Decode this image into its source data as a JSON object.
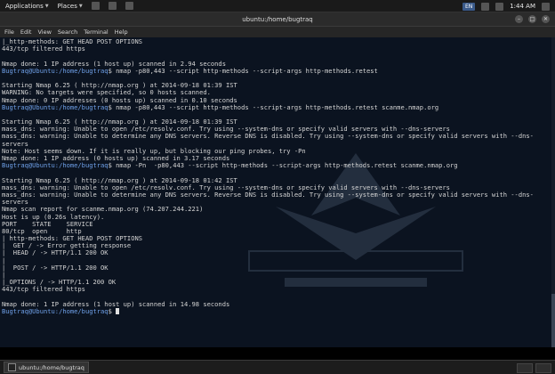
{
  "topbar": {
    "applications": "Applications",
    "places": "Places",
    "keyboard_layout": "EN",
    "time": "1:44 AM"
  },
  "window": {
    "title": "ubuntu:/home/bugtraq"
  },
  "menubar": [
    "File",
    "Edit",
    "View",
    "Search",
    "Terminal",
    "Help"
  ],
  "terminal": {
    "prompt_user": "Bugtraq@Ubuntu:",
    "prompt_path": "/home/bugtraq",
    "lines": [
      {
        "text": "|_http-methods: GET HEAD POST OPTIONS"
      },
      {
        "text": "443/tcp filtered https"
      },
      {
        "text": ""
      },
      {
        "text": "Nmap done: 1 IP address (1 host up) scanned in 2.94 seconds"
      },
      {
        "prompt": true,
        "text": "$ nmap -p80,443 --script http-methods --script-args http-methods.retest"
      },
      {
        "text": ""
      },
      {
        "text": "Starting Nmap 6.25 ( http://nmap.org ) at 2014-09-18 01:39 IST"
      },
      {
        "text": "WARNING: No targets were specified, so 0 hosts scanned."
      },
      {
        "text": "Nmap done: 0 IP addresses (0 hosts up) scanned in 0.10 seconds"
      },
      {
        "prompt": true,
        "text": "$ nmap -p80,443 --script http-methods --script-args http-methods.retest scanme.nmap.org"
      },
      {
        "text": ""
      },
      {
        "text": "Starting Nmap 6.25 ( http://nmap.org ) at 2014-09-18 01:39 IST"
      },
      {
        "text": "mass_dns: warning: Unable to open /etc/resolv.conf. Try using --system-dns or specify valid servers with --dns-servers"
      },
      {
        "text": "mass_dns: warning: Unable to determine any DNS servers. Reverse DNS is disabled. Try using --system-dns or specify valid servers with --dns-"
      },
      {
        "text": "servers"
      },
      {
        "text": "Note: Host seems down. If it is really up, but blocking our ping probes, try -Pn"
      },
      {
        "text": "Nmap done: 1 IP address (0 hosts up) scanned in 3.17 seconds"
      },
      {
        "prompt": true,
        "text": "$ nmap -Pn  -p80,443 --script http-methods --script-args http-methods.retest scanme.nmap.org"
      },
      {
        "text": ""
      },
      {
        "text": "Starting Nmap 6.25 ( http://nmap.org ) at 2014-09-18 01:42 IST"
      },
      {
        "text": "mass_dns: warning: Unable to open /etc/resolv.conf. Try using --system-dns or specify valid servers with --dns-servers"
      },
      {
        "text": "mass_dns: warning: Unable to determine any DNS servers. Reverse DNS is disabled. Try using --system-dns or specify valid servers with --dns-"
      },
      {
        "text": "servers"
      },
      {
        "text": "Nmap scan report for scanme.nmap.org (74.207.244.221)"
      },
      {
        "text": "Host is up (0.26s latency)."
      },
      {
        "text": "PORT    STATE    SERVICE"
      },
      {
        "text": "80/tcp  open     http"
      },
      {
        "text": "| http-methods: GET HEAD POST OPTIONS"
      },
      {
        "text": "|  GET / -> Error getting response"
      },
      {
        "text": "|  HEAD / -> HTTP/1.1 200 OK"
      },
      {
        "text": "|"
      },
      {
        "text": "|  POST / -> HTTP/1.1 200 OK"
      },
      {
        "text": "|"
      },
      {
        "text": "|_OPTIONS / -> HTTP/1.1 200 OK"
      },
      {
        "text": "443/tcp filtered https"
      },
      {
        "text": ""
      },
      {
        "text": "Nmap done: 1 IP address (1 host up) scanned in 14.98 seconds"
      },
      {
        "prompt": true,
        "text": "$ ",
        "cursor": true
      }
    ]
  },
  "taskbar": {
    "task_label": "ubuntu:/home/bugtraq"
  }
}
